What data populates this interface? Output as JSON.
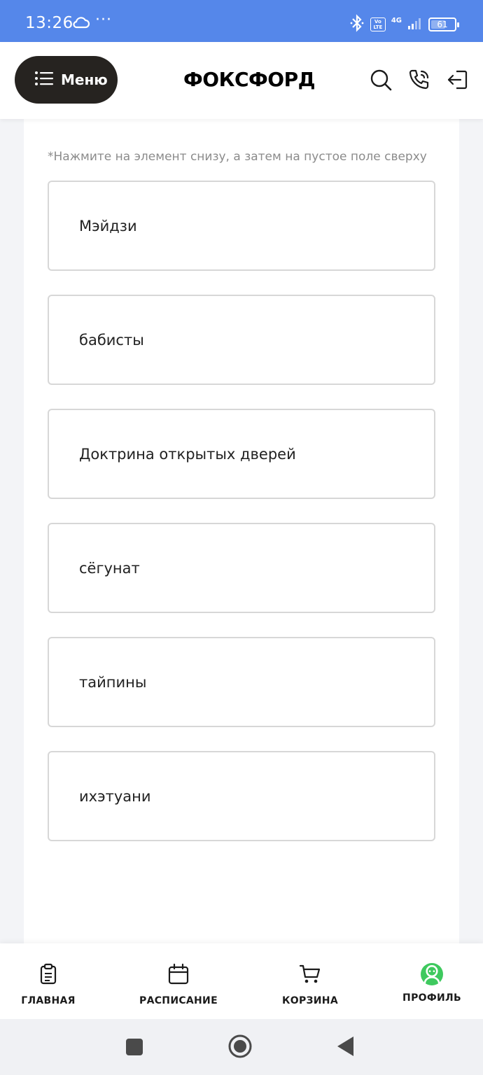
{
  "status_bar": {
    "time": "13:26",
    "dots": "···",
    "volte": "Vo LTE",
    "network": "4G",
    "battery": "61",
    "battery_level_percent": 61
  },
  "header": {
    "menu_label": "Меню",
    "logo_text": "ФОКСФОРД"
  },
  "task": {
    "hint": "*Нажмите на элемент снизу, а затем на пустое поле сверху",
    "options": [
      "Мэйдзи",
      "бабисты",
      "Доктрина открытых дверей",
      "сёгунат",
      "тайпины",
      "ихэтуани"
    ]
  },
  "bottom_nav": {
    "items": [
      {
        "label": "ГЛАВНАЯ",
        "icon": "clipboard-icon"
      },
      {
        "label": "РАСПИСАНИЕ",
        "icon": "calendar-icon"
      },
      {
        "label": "КОРЗИНА",
        "icon": "cart-icon"
      },
      {
        "label": "ПРОФИЛЬ",
        "icon": "avatar-icon"
      }
    ]
  },
  "colors": {
    "status_bar": "#5587ea",
    "menu_button": "#262320",
    "avatar": "#3ec95e",
    "option_border": "#d7d7d7"
  }
}
